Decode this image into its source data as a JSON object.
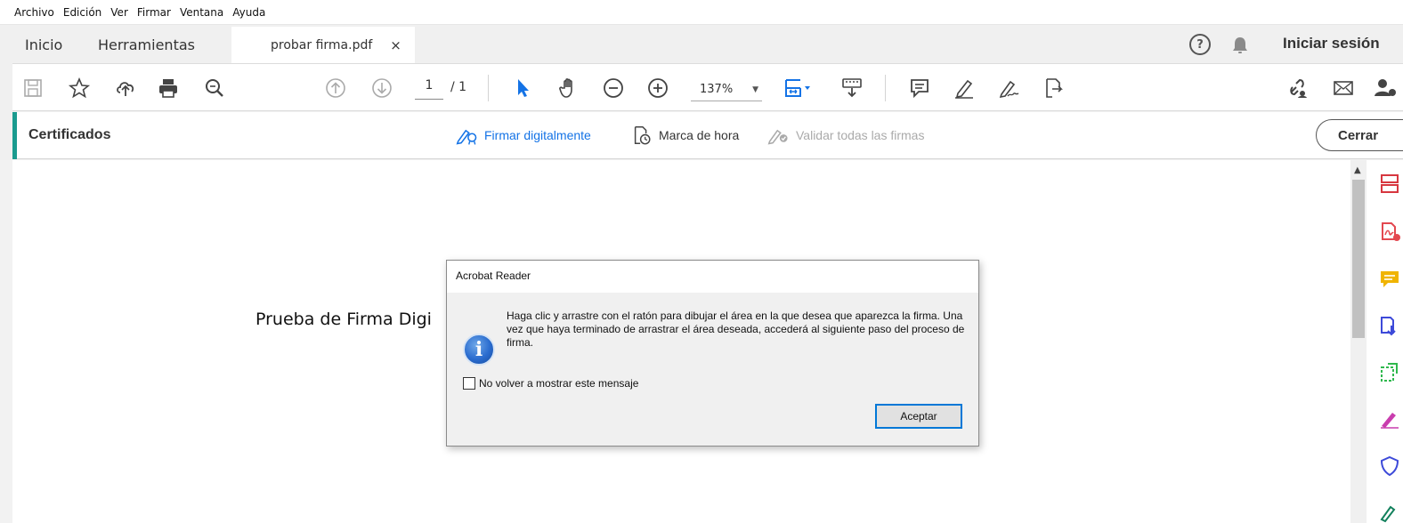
{
  "menu": [
    "Archivo",
    "Edición",
    "Ver",
    "Firmar",
    "Ventana",
    "Ayuda"
  ],
  "tabs": {
    "home": "Inicio",
    "tools": "Herramientas",
    "document": "probar firma.pdf",
    "close_symbol": "×"
  },
  "header": {
    "help_symbol": "?",
    "signin": "Iniciar sesión"
  },
  "toolbar": {
    "page_current": "1",
    "page_total": "/ 1",
    "zoom": "137%",
    "zoom_caret": "▼"
  },
  "certificates": {
    "title": "Certificados",
    "sign_digitally": "Firmar digitalmente",
    "timestamp": "Marca de hora",
    "validate_all": "Validar todas las firmas",
    "close": "Cerrar",
    "accent_color": "#1a9b8f",
    "link_color": "#1473e6"
  },
  "document": {
    "text": "Prueba de Firma Digi"
  },
  "scrollbar": {
    "up_arrow": "▲"
  },
  "dialog": {
    "title": "Acrobat Reader",
    "icon_letter": "i",
    "message": "Haga clic y arrastre con el ratón para dibujar el área en la que desea que aparezca la firma. Una vez que haya terminado de arrastrar el área deseada, accederá al siguiente paso del proceso de firma.",
    "checkbox_label": "No volver a mostrar este mensaje",
    "checkbox_checked": false,
    "ok": "Aceptar"
  }
}
